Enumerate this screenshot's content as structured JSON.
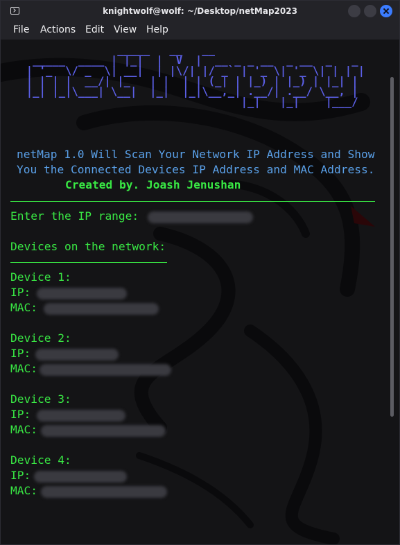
{
  "window": {
    "title": "knightwolf@wolf: ~/Desktop/netMap2023"
  },
  "menu": [
    "File",
    "Actions",
    "Edit",
    "View",
    "Help"
  ],
  "terminal": {
    "banner": [
      "                _____   __   __",
      "   _____  ____ | |_|  |  V  |  __ _ _ __  _ __  _   _",
      "  | '_  \\/ _  \\| __|  | |\\/| |/ _` | '_ \\| '_ \\| | | |",
      "  | | | |  __/| |_   | |  | | (_| | |_) | |_) | |_| |",
      "  |_| |_|\\___| \\__|  |_|  |_|\\__,_| .__/| .__/ \\__, |",
      "                                   |_|   |_|    |___/"
    ],
    "intro_line1": "netMap 1.0 Will Scan Your Network IP Address and Show",
    "intro_line2": "You the Connected Devices IP Address and MAC Address.",
    "credit": "Created by. Joash Jenushan",
    "prompt": "Enter the IP range:",
    "devices_header": "Devices on the network:",
    "ip_label": "IP:",
    "mac_label": "MAC:",
    "devices": [
      {
        "name": "Device 1:"
      },
      {
        "name": "Device 2:"
      },
      {
        "name": "Device 3:"
      },
      {
        "name": "Device 4:"
      }
    ]
  },
  "colors": {
    "banner": "#5b5fe6",
    "intro": "#5aa0e8",
    "output": "#39e844",
    "close_button": "#3b7cff"
  }
}
